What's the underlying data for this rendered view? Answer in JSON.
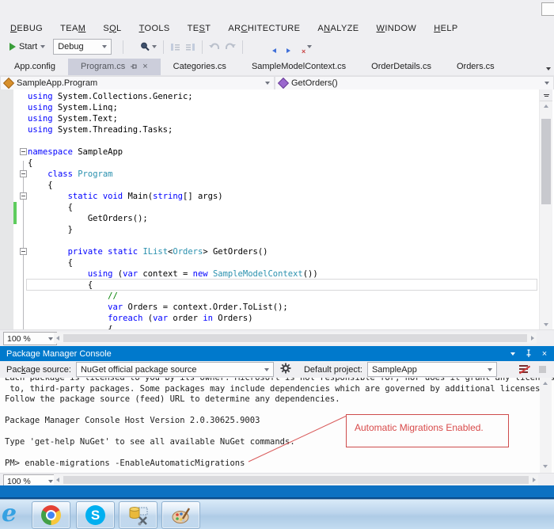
{
  "menu": {
    "items": [
      {
        "label": "DEBUG",
        "u": 0
      },
      {
        "label": "TEAM",
        "u": 3
      },
      {
        "label": "SQL",
        "u": 1
      },
      {
        "label": "TOOLS",
        "u": 0
      },
      {
        "label": "TEST",
        "u": 2
      },
      {
        "label": "ARCHITECTURE",
        "u": 2
      },
      {
        "label": "ANALYZE",
        "u": 1
      },
      {
        "label": "WINDOW",
        "u": 0
      },
      {
        "label": "HELP",
        "u": 0
      }
    ]
  },
  "toolbar": {
    "start_label": "Start",
    "debug_label": "Debug"
  },
  "tabs": {
    "items": [
      {
        "label": "App.config",
        "active": false
      },
      {
        "label": "Program.cs",
        "active": true
      },
      {
        "label": "Categories.cs",
        "active": false
      },
      {
        "label": "SampleModelContext.cs",
        "active": false
      },
      {
        "label": "OrderDetails.cs",
        "active": false
      },
      {
        "label": "Orders.cs",
        "active": false
      }
    ]
  },
  "navbar": {
    "type_name": "SampleApp.Program",
    "member_name": "GetOrders()"
  },
  "editor": {
    "zoom": "100 %",
    "lines": [
      {
        "t": [
          [
            "k",
            "using"
          ],
          [
            "p",
            " System.Collections.Generic;"
          ]
        ]
      },
      {
        "t": [
          [
            "k",
            "using"
          ],
          [
            "p",
            " System.Linq;"
          ]
        ]
      },
      {
        "t": [
          [
            "k",
            "using"
          ],
          [
            "p",
            " System.Text;"
          ]
        ]
      },
      {
        "t": [
          [
            "k",
            "using"
          ],
          [
            "p",
            " System.Threading.Tasks;"
          ]
        ]
      },
      {
        "t": []
      },
      {
        "t": [
          [
            "k",
            "namespace"
          ],
          [
            "p",
            " SampleApp"
          ]
        ],
        "f": true
      },
      {
        "t": [
          [
            "p",
            "{"
          ]
        ]
      },
      {
        "t": [
          [
            "p",
            "    "
          ],
          [
            "k",
            "class"
          ],
          [
            "p",
            " "
          ],
          [
            "t",
            "Program"
          ]
        ],
        "f": true
      },
      {
        "t": [
          [
            "p",
            "    {"
          ]
        ]
      },
      {
        "t": [
          [
            "p",
            "        "
          ],
          [
            "k",
            "static"
          ],
          [
            "p",
            " "
          ],
          [
            "k",
            "void"
          ],
          [
            "p",
            " Main("
          ],
          [
            "k",
            "string"
          ],
          [
            "p",
            "[] args)"
          ]
        ],
        "f": true
      },
      {
        "t": [
          [
            "p",
            "        {"
          ]
        ],
        "g": true
      },
      {
        "t": [
          [
            "p",
            "            GetOrders();"
          ]
        ],
        "g": true
      },
      {
        "t": [
          [
            "p",
            "        }"
          ]
        ]
      },
      {
        "t": []
      },
      {
        "t": [
          [
            "p",
            "        "
          ],
          [
            "k",
            "private"
          ],
          [
            "p",
            " "
          ],
          [
            "k",
            "static"
          ],
          [
            "p",
            " "
          ],
          [
            "t",
            "IList"
          ],
          [
            "p",
            "<"
          ],
          [
            "t",
            "Orders"
          ],
          [
            "p",
            "> GetOrders()"
          ]
        ],
        "f": true
      },
      {
        "t": [
          [
            "p",
            "        {"
          ]
        ]
      },
      {
        "t": [
          [
            "p",
            "            "
          ],
          [
            "k",
            "using"
          ],
          [
            "p",
            " ("
          ],
          [
            "k",
            "var"
          ],
          [
            "p",
            " context = "
          ],
          [
            "k",
            "new"
          ],
          [
            "p",
            " "
          ],
          [
            "t",
            "SampleModelContext"
          ],
          [
            "p",
            "())"
          ]
        ]
      },
      {
        "t": [
          [
            "p",
            "            {"
          ]
        ],
        "c": true
      },
      {
        "t": [
          [
            "p",
            "                "
          ],
          [
            "c",
            "//"
          ]
        ]
      },
      {
        "t": [
          [
            "p",
            "                "
          ],
          [
            "k",
            "var"
          ],
          [
            "p",
            " Orders = context.Order.ToList();"
          ]
        ]
      },
      {
        "t": [
          [
            "p",
            "                "
          ],
          [
            "k",
            "foreach"
          ],
          [
            "p",
            " ("
          ],
          [
            "k",
            "var"
          ],
          [
            "p",
            " order "
          ],
          [
            "k",
            "in"
          ],
          [
            "p",
            " Orders)"
          ]
        ]
      },
      {
        "t": [
          [
            "p",
            "                {"
          ]
        ]
      }
    ],
    "syntax_colors": {
      "keyword": "#0000FF",
      "type": "#2B91AF",
      "comment": "#008000",
      "plain": "#000000"
    }
  },
  "console_panel": {
    "title": "Package Manager Console",
    "package_source": {
      "label": "Package source:",
      "u": 3
    },
    "package_source_value": "NuGet official package source",
    "default_project": {
      "label": "Default project:",
      "u": -1
    },
    "default_project_value": "SampleApp",
    "zoom": "100 %",
    "lines": [
      "Each package is licensed to you by its owner. Microsoft is not responsible for, nor does it grant any licenses",
      " to, third-party packages. Some packages may include dependencies which are governed by additional licenses.",
      "Follow the package source (feed) URL to determine any dependencies.",
      "",
      "Package Manager Console Host Version 2.0.30625.9003",
      "",
      "Type 'get-help NuGet' to see all available NuGet commands.",
      "",
      "PM> enable-migrations -EnableAutomaticMigrations"
    ],
    "annotation": {
      "text": "Automatic Migrations Enabled.",
      "color": "#D84A4A"
    }
  },
  "taskbar": {
    "apps": [
      "internet-explorer-icon",
      "chrome-icon",
      "skype-icon",
      "sql-data-tools-icon",
      "paint-icon"
    ]
  },
  "colors": {
    "window_bg": "#EFEFF2",
    "active_tab_bg": "#CCCEDB",
    "panel_title_bg": "#0079CC",
    "status_bar_bg": "#0D71C2",
    "change_bar": "#5ECC5E",
    "annotation_red": "#D84A4A"
  }
}
